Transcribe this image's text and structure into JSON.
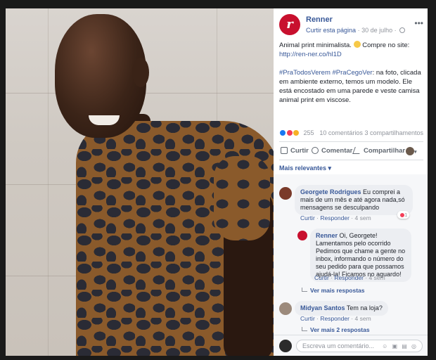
{
  "page": {
    "name": "Renner",
    "meta_like": "Curtir esta página",
    "date": "30 de julho",
    "sep": "·"
  },
  "post": {
    "line1": "Animal print minimalista.",
    "line1b": "Compre no site:",
    "link": "http://ren-ner.co/hl1D",
    "hashtags": "#PraTodosVerem #PraCegoVer",
    "body": ": na foto, clicada em ambiente externo, temos um modelo. Ele está encostado em uma parede e veste camisa animal print em viscose."
  },
  "reactions": {
    "count": "255",
    "comments": "10 comentários",
    "shares": "3 compartilhamentos",
    "colors": {
      "like": "#1877f2",
      "love": "#f33e58",
      "wow": "#f7b125"
    }
  },
  "actions": {
    "like": "Curtir",
    "comment": "Comentar",
    "share": "Compartilhar"
  },
  "sort": "Mais relevantes ▾",
  "comments": [
    {
      "author": "Georgete Rodrigues",
      "text": "Eu comprei a mais de um mês e até agora nada,só mensagens se desculpando",
      "like": "Curtir",
      "reply": "Responder",
      "time": "4 sem",
      "reaction_count": "1"
    },
    {
      "author": "Renner",
      "text": "Oi, Georgete! Lamentamos pelo ocorrido Pedimos que chame a gente no inbox, informando o número do seu pedido para que possamos ajudá-la! Ficamos no aguardo!",
      "like": "Curtir",
      "reply": "Responder",
      "time": "4 sem"
    },
    {
      "author": "Midyan Santos",
      "text": "Tem na loja?",
      "like": "Curtir",
      "reply": "Responder",
      "time": "4 sem"
    }
  ],
  "reply_links": {
    "more1": "Ver mais respostas",
    "more2": "Ver mais 2 respostas",
    "more3": "Ver mais respostas"
  },
  "composer": {
    "placeholder": "Escreva um comentário..."
  }
}
